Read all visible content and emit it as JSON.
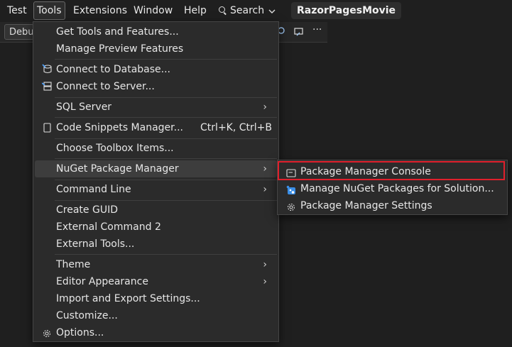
{
  "menubar": {
    "items": [
      "Test",
      "Tools",
      "Extensions",
      "Window",
      "Help"
    ],
    "search_label": "Search",
    "project_name": "RazorPagesMovie"
  },
  "toolbar": {
    "config_label": "Debu",
    "more_label": "···"
  },
  "tools_menu": {
    "items": [
      {
        "label": "Get Tools and Features..."
      },
      {
        "label": "Manage Preview Features"
      },
      {
        "label": "Connect to Database..."
      },
      {
        "label": "Connect to Server..."
      },
      {
        "label": "SQL Server"
      },
      {
        "label": "Code Snippets Manager...",
        "shortcut": "Ctrl+K, Ctrl+B"
      },
      {
        "label": "Choose Toolbox Items..."
      },
      {
        "label": "NuGet Package Manager"
      },
      {
        "label": "Command Line"
      },
      {
        "label": "Create GUID"
      },
      {
        "label": "External Command 2"
      },
      {
        "label": "External Tools..."
      },
      {
        "label": "Theme"
      },
      {
        "label": "Editor Appearance"
      },
      {
        "label": "Import and Export Settings..."
      },
      {
        "label": "Customize..."
      },
      {
        "label": "Options..."
      }
    ]
  },
  "nuget_submenu": {
    "items": [
      {
        "label": "Package Manager Console"
      },
      {
        "label": "Manage NuGet Packages for Solution..."
      },
      {
        "label": "Package Manager Settings"
      }
    ]
  },
  "colors": {
    "highlight_border": "#e0202c",
    "menu_bg": "#2b2b2b",
    "app_bg": "#1f1f1f"
  }
}
